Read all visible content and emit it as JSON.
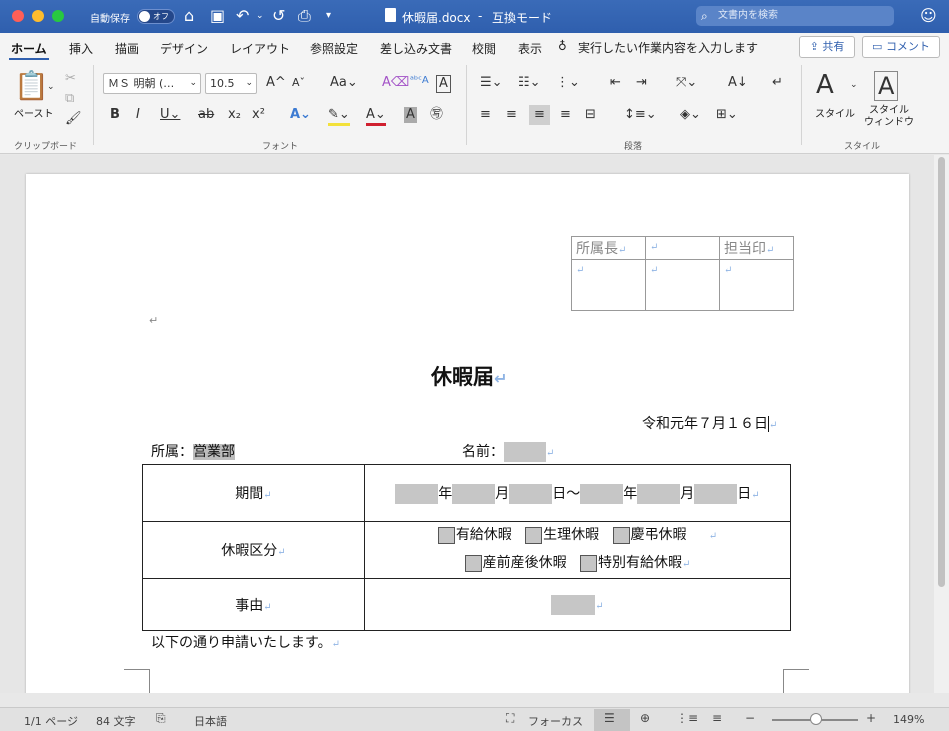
{
  "titlebar": {
    "autosave": "自動保存",
    "toggle_state": "オフ",
    "doc_title": "休暇届.docx",
    "separator": "-",
    "mode": "互換モード",
    "search_placeholder": "文書内を検索"
  },
  "ribbon": {
    "tabs": [
      "ホーム",
      "挿入",
      "描画",
      "デザイン",
      "レイアウト",
      "参照設定",
      "差し込み文書",
      "校閲",
      "表示"
    ],
    "tellme": "実行したい作業内容を入力します",
    "share": "共有",
    "comment": "コメント",
    "paste": "ペースト",
    "font_name": "ＭＳ 明朝 (…",
    "font_size": "10.5",
    "style_btn": "スタイル",
    "style_window": "スタイル\nウィンドウ",
    "groups": {
      "clipboard": "クリップボード",
      "font": "フォント",
      "paragraph": "段落",
      "styles": "スタイル"
    }
  },
  "doc": {
    "stamp": {
      "header": [
        "所属長",
        "",
        "担当印"
      ]
    },
    "title": "休暇届",
    "date": "令和元年７月１６日",
    "affiliation_label": "所属：",
    "affiliation_value": "営業部",
    "name_label": "名前：",
    "rows": {
      "period_label": "期間",
      "period_parts": [
        "年",
        "月",
        "日～",
        "年",
        "月",
        "日"
      ],
      "type_label": "休暇区分",
      "types_line1": [
        "有給休暇",
        "生理休暇",
        "慶弔休暇"
      ],
      "types_line2": [
        "産前産後休暇",
        "特別有給休暇"
      ],
      "reason_label": "事由"
    },
    "request": "以下の通り申請いたします。"
  },
  "statusbar": {
    "page": "1/1 ページ",
    "words": "84 文字",
    "lang": "日本語",
    "focus": "フォーカス",
    "zoom": "149%"
  }
}
